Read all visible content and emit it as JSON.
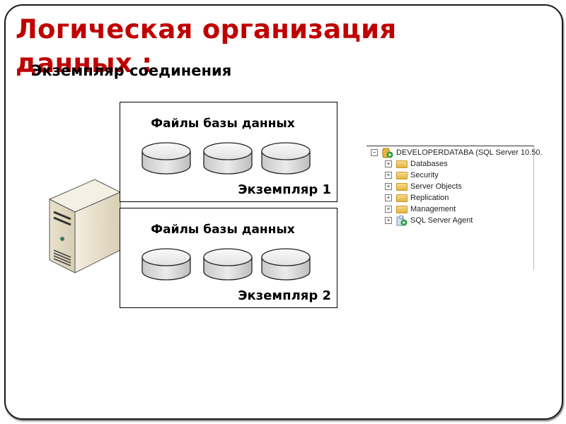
{
  "slide": {
    "title": "Логическая организация данных :",
    "subtitle": "Экземпляр соединения"
  },
  "diagram": {
    "instances": [
      {
        "files_label": "Файлы базы данных",
        "label": "Экземпляр 1",
        "disk_count": 3
      },
      {
        "files_label": "Файлы базы данных",
        "label": "Экземпляр 2",
        "disk_count": 3
      }
    ],
    "server_icon": "server-tower-icon",
    "disk_icon": "database-disk-icon"
  },
  "object_explorer": {
    "root": {
      "label": "DEVELOPERDATABA (SQL Server 10.50.",
      "expander": "−",
      "icon": "server-instance-icon"
    },
    "children": [
      {
        "label": "Databases",
        "expander": "+",
        "icon": "folder-icon"
      },
      {
        "label": "Security",
        "expander": "+",
        "icon": "folder-icon"
      },
      {
        "label": "Server Objects",
        "expander": "+",
        "icon": "folder-icon"
      },
      {
        "label": "Replication",
        "expander": "+",
        "icon": "folder-icon"
      },
      {
        "label": "Management",
        "expander": "+",
        "icon": "folder-icon"
      },
      {
        "label": "SQL Server Agent",
        "expander": "+",
        "icon": "sql-agent-icon"
      }
    ]
  },
  "colors": {
    "title": "#c00000",
    "text": "#000000"
  }
}
